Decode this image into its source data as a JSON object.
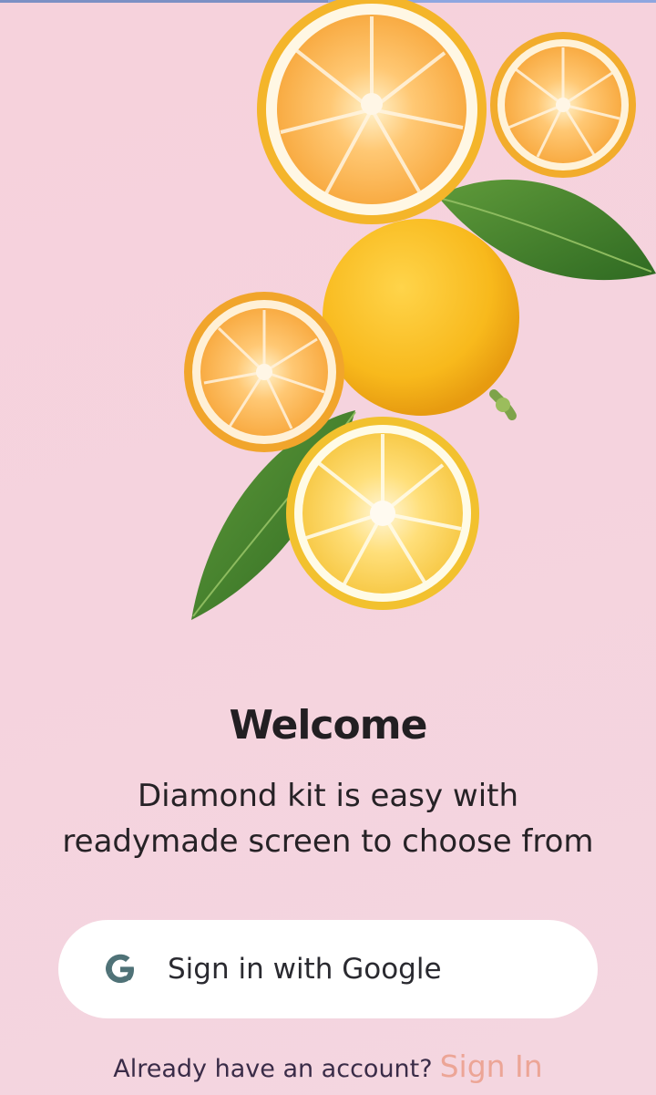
{
  "welcome": {
    "title": "Welcome",
    "subtitle_line1": "Diamond kit is easy with",
    "subtitle_line2": "readymade screen to choose from"
  },
  "google_button": {
    "label": "Sign in with Google",
    "icon": "google-g-icon"
  },
  "signin": {
    "prompt": "Already have an account?",
    "link": "Sign In"
  },
  "colors": {
    "background": "#f5d3de",
    "title": "#221f22",
    "button_bg": "#ffffff",
    "link": "#eca596",
    "google_icon": "#4f7277"
  },
  "hero": {
    "image": "lemons-and-leaves-illustration"
  }
}
